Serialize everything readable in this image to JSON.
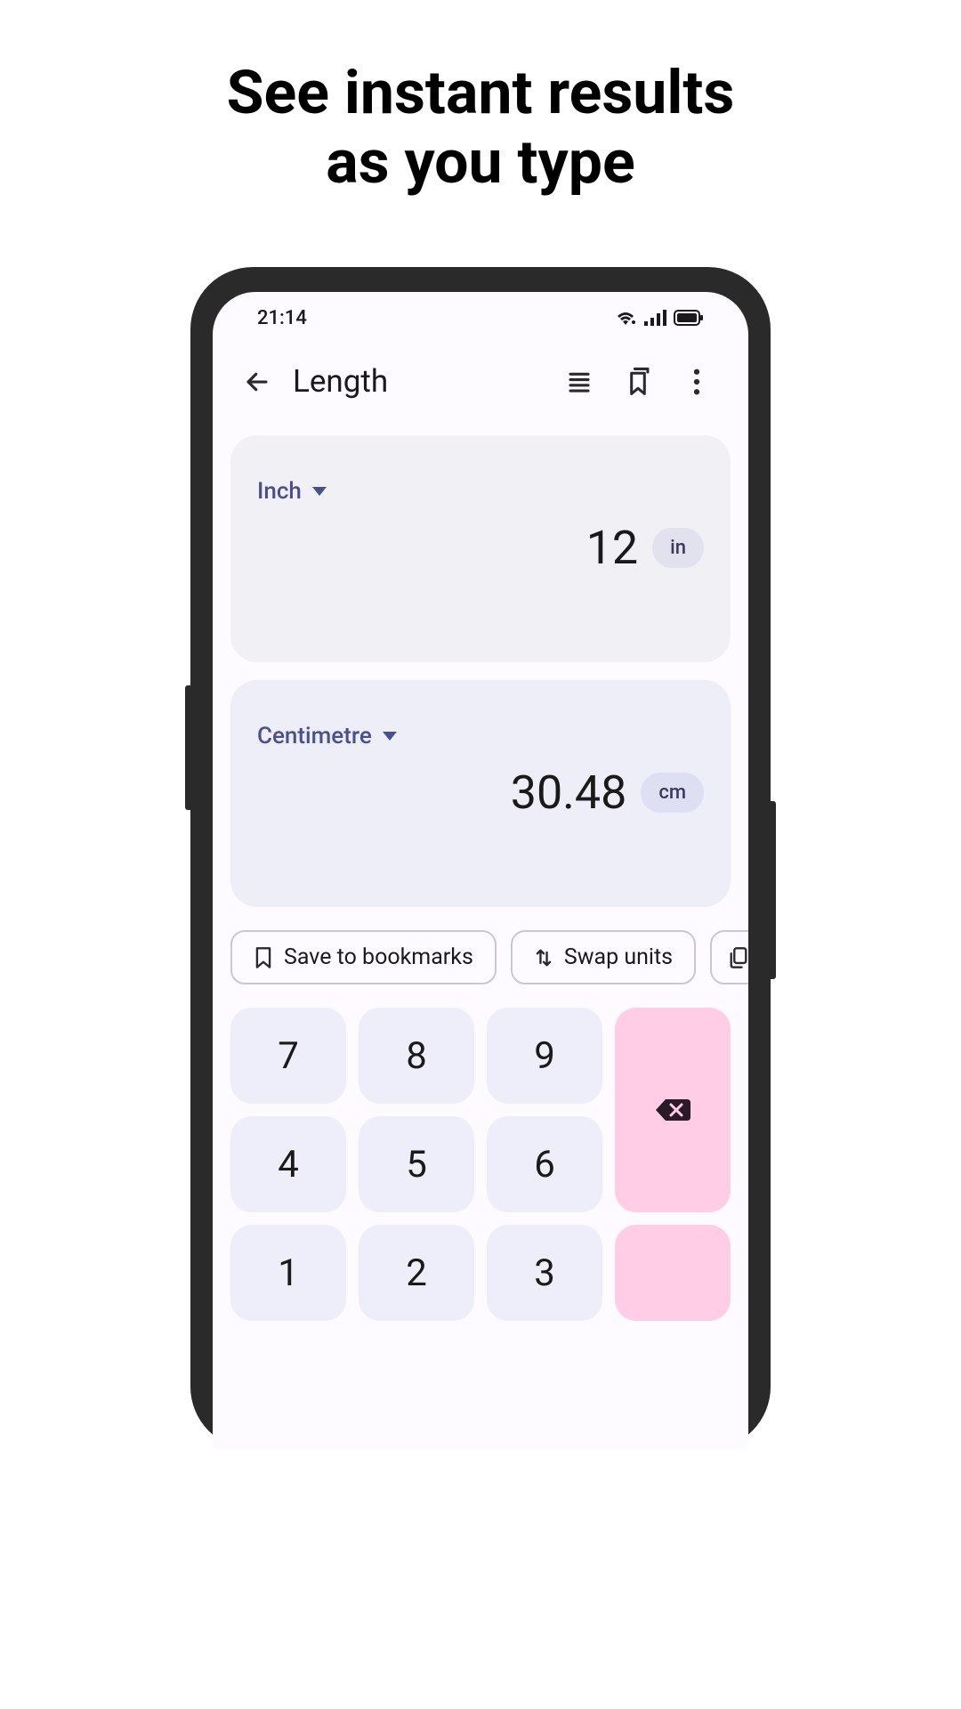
{
  "headline": "See instant results\nas you type",
  "statusBar": {
    "time": "21:14"
  },
  "header": {
    "title": "Length"
  },
  "from": {
    "unitName": "Inch",
    "value": "12",
    "unitShort": "in"
  },
  "to": {
    "unitName": "Centimetre",
    "value": "30.48",
    "unitShort": "cm"
  },
  "actions": {
    "bookmark": "Save to bookmarks",
    "swap": "Swap units"
  },
  "keypad": {
    "k7": "7",
    "k8": "8",
    "k9": "9",
    "k4": "4",
    "k5": "5",
    "k6": "6",
    "k1": "1",
    "k2": "2",
    "k3": "3"
  }
}
